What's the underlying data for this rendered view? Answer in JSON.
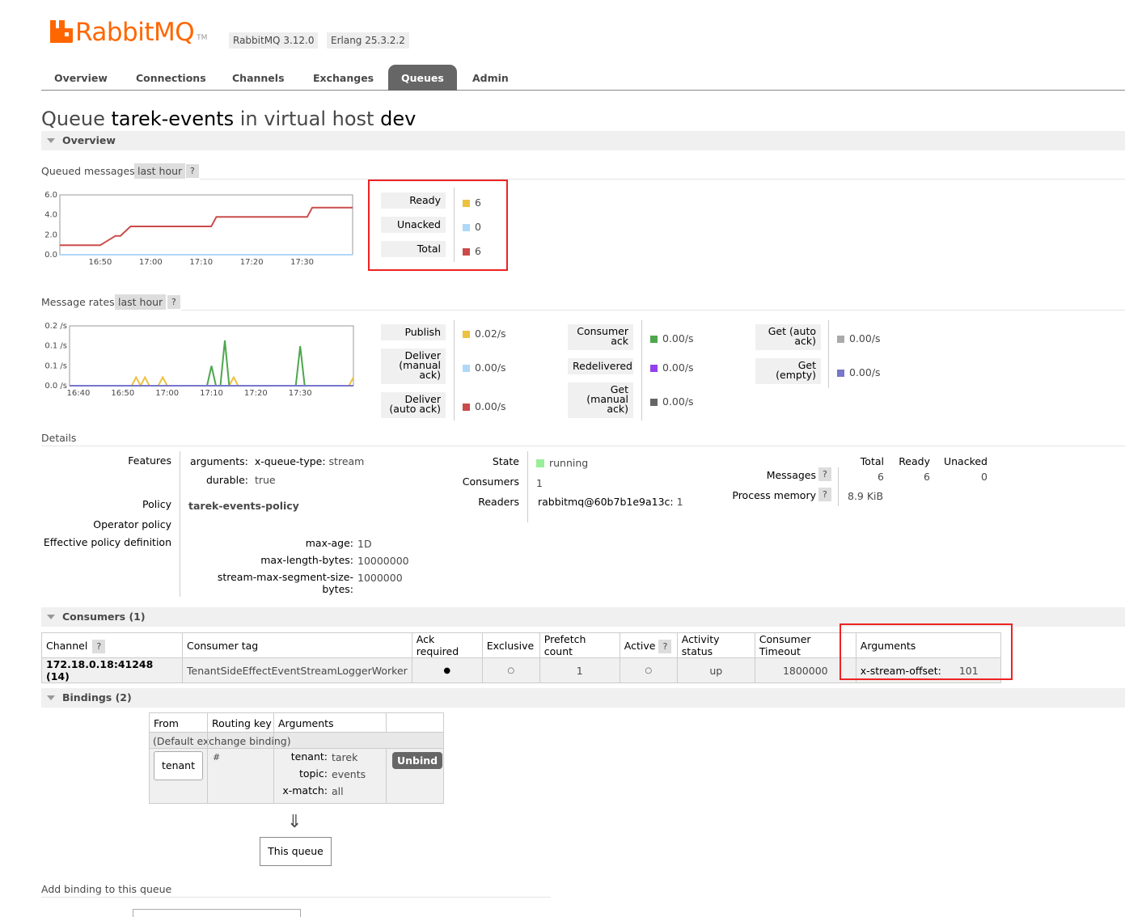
{
  "header": {
    "brand": "RabbitMQ",
    "trademark": "TM",
    "version_badge": "RabbitMQ 3.12.0",
    "erlang_badge": "Erlang 25.3.2.2"
  },
  "tabs": [
    {
      "label": "Overview",
      "active": false
    },
    {
      "label": "Connections",
      "active": false
    },
    {
      "label": "Channels",
      "active": false
    },
    {
      "label": "Exchanges",
      "active": false
    },
    {
      "label": "Queues",
      "active": true
    },
    {
      "label": "Admin",
      "active": false
    }
  ],
  "title": {
    "prefix": "Queue",
    "queue": "tarek-events",
    "middle": "in virtual host",
    "vhost": "dev"
  },
  "overview_section": "Overview",
  "queued": {
    "label": "Queued messages",
    "range": "last hour",
    "help": "?",
    "legend": [
      {
        "label": "Ready",
        "value": "6",
        "color": "#edc240"
      },
      {
        "label": "Unacked",
        "value": "0",
        "color": "#afd8f8"
      },
      {
        "label": "Total",
        "value": "6",
        "color": "#cb4b4b"
      }
    ]
  },
  "rates": {
    "label": "Message rates",
    "range": "last hour",
    "help": "?",
    "col1": [
      {
        "label": "Publish",
        "value": "0.02/s",
        "color": "#edc240"
      },
      {
        "label": "Deliver (manual ack)",
        "value": "0.00/s",
        "color": "#afd8f8"
      },
      {
        "label": "Deliver (auto ack)",
        "value": "0.00/s",
        "color": "#cb4b4b"
      }
    ],
    "col2": [
      {
        "label": "Consumer ack",
        "value": "0.00/s",
        "color": "#4da74d"
      },
      {
        "label": "Redelivered",
        "value": "0.00/s",
        "color": "#9440ed"
      },
      {
        "label": "Get (manual ack)",
        "value": "0.00/s",
        "color": "#666666"
      }
    ],
    "col3": [
      {
        "label": "Get (auto ack)",
        "value": "0.00/s",
        "color": "#aaaaaa"
      },
      {
        "label": "Get (empty)",
        "value": "0.00/s",
        "color": "#7777cc"
      }
    ]
  },
  "chart_data": [
    {
      "type": "line",
      "x_ticks": [
        "16:50",
        "17:00",
        "17:10",
        "17:20",
        "17:30"
      ],
      "y_ticks": [
        "6.0",
        "4.0",
        "2.0",
        "0.0"
      ],
      "ylim": [
        0,
        6
      ],
      "series": [
        {
          "name": "Total",
          "color": "#cb4b4b",
          "x": [
            "16:42",
            "16:50",
            "16:50",
            "16:53",
            "16:54",
            "16:56",
            "17:12",
            "17:13",
            "17:31",
            "17:32",
            "17:40"
          ],
          "values": [
            1,
            1,
            1,
            2,
            2,
            3,
            3,
            4,
            4,
            5,
            5
          ]
        },
        {
          "name": "Ready",
          "color": "#edc240",
          "x": [
            "16:42",
            "17:40"
          ],
          "values": [
            0,
            0
          ]
        },
        {
          "name": "Unacked",
          "color": "#afd8f8",
          "x": [
            "16:42",
            "17:40"
          ],
          "values": [
            0,
            0
          ]
        }
      ]
    },
    {
      "type": "line",
      "x_ticks": [
        "16:40",
        "16:50",
        "17:00",
        "17:10",
        "17:20",
        "17:30"
      ],
      "y_ticks": [
        "0.2 /s",
        "0.1 /s",
        "0.1 /s",
        "0.0 /s"
      ],
      "ylim": [
        0,
        0.2
      ],
      "series": [
        {
          "name": "Publish",
          "color": "#edc240",
          "x": [
            "16:38",
            "16:52",
            "16:53",
            "16:54",
            "16:55",
            "16:56",
            "16:58",
            "16:59",
            "17:00",
            "17:14",
            "17:15",
            "17:16",
            "17:41",
            "17:42"
          ],
          "values": [
            0,
            0,
            0.03,
            0,
            0.03,
            0,
            0,
            0.03,
            0,
            0,
            0.03,
            0,
            0,
            0.03
          ]
        },
        {
          "name": "Consumer ack",
          "color": "#4da74d",
          "x": [
            "16:38",
            "17:09",
            "17:10",
            "17:11",
            "17:12",
            "17:13",
            "17:14",
            "17:29",
            "17:30",
            "17:31",
            "17:42"
          ],
          "values": [
            0,
            0,
            0.07,
            0,
            0,
            0.16,
            0,
            0,
            0.14,
            0,
            0
          ]
        },
        {
          "name": "Get (empty)",
          "color": "#7777cc",
          "x": [
            "16:38",
            "17:42"
          ],
          "values": [
            0,
            0
          ]
        }
      ]
    }
  ],
  "details": {
    "label": "Details",
    "features_label": "Features",
    "arg_key": "arguments:",
    "arg_name": "x-queue-type:",
    "arg_value": "stream",
    "durable_key": "durable:",
    "durable_value": "true",
    "policy_label": "Policy",
    "policy_value": "tarek-events-policy",
    "operator_policy_label": "Operator policy",
    "effective_label": "Effective policy definition",
    "effective": [
      {
        "key": "max-age:",
        "value": "1D"
      },
      {
        "key": "max-length-bytes:",
        "value": "10000000"
      },
      {
        "key": "stream-max-segment-size-bytes:",
        "value": "1000000"
      }
    ],
    "state_label": "State",
    "state_value": "running",
    "consumers_label": "Consumers",
    "consumers_value": "1",
    "readers_label": "Readers",
    "readers_node": "rabbitmq@60b7b1e9a13c:",
    "readers_count": "1",
    "messages_label": "Messages",
    "memory_label": "Process memory",
    "help": "?",
    "cols": [
      "Total",
      "Ready",
      "Unacked"
    ],
    "messages": [
      "6",
      "6",
      "0"
    ],
    "memory": "8.9 KiB"
  },
  "consumers": {
    "section": "Consumers (1)",
    "headers": [
      "Channel",
      "Consumer tag",
      "Ack required",
      "Exclusive",
      "Prefetch count",
      "Active",
      "Activity status",
      "Consumer Timeout",
      "Arguments"
    ],
    "help": "?",
    "row": {
      "channel": "172.18.0.18:41248 (14)",
      "tag": "TenantSideEffectEventStreamLoggerWorker",
      "ack": "●",
      "exclusive": "○",
      "prefetch": "1",
      "active": "○",
      "status": "up",
      "timeout": "1800000",
      "arg_key": "x-stream-offset:",
      "arg_value": "101"
    }
  },
  "bindings": {
    "section": "Bindings (2)",
    "headers": [
      "From",
      "Routing key",
      "Arguments"
    ],
    "default_row": "(Default exchange binding)",
    "from": "tenant",
    "routing_key": "#",
    "args": [
      {
        "key": "tenant:",
        "value": "tarek"
      },
      {
        "key": "topic:",
        "value": "events"
      },
      {
        "key": "x-match:",
        "value": "all"
      }
    ],
    "unbind": "Unbind",
    "arrow": "⇓",
    "this_queue": "This queue"
  },
  "add_binding": "Add binding to this queue"
}
